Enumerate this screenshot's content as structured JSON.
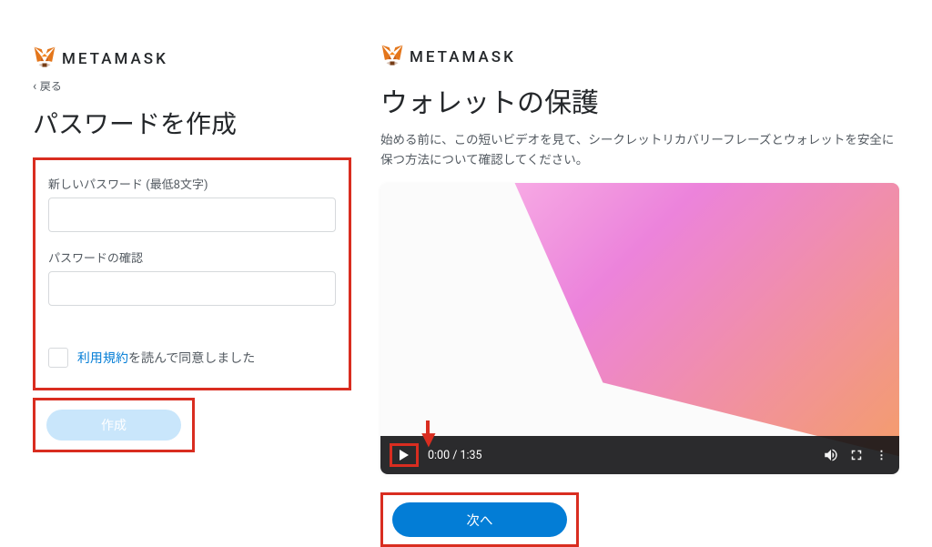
{
  "brand": {
    "name": "METAMASK"
  },
  "left": {
    "back": "戻る",
    "heading": "パスワードを作成",
    "pw_label": "新しいパスワード (最低8文字)",
    "pw_confirm_label": "パスワードの確認",
    "terms_link": "利用規約",
    "terms_rest": "を読んで同意しました",
    "create_btn": "作成"
  },
  "right": {
    "heading": "ウォレットの保護",
    "desc": "始める前に、この短いビデオを見て、シークレットリカバリーフレーズとウォレットを安全に保つ方法について確認してください。",
    "video": {
      "time": "0:00 / 1:35"
    },
    "next_btn": "次へ"
  }
}
